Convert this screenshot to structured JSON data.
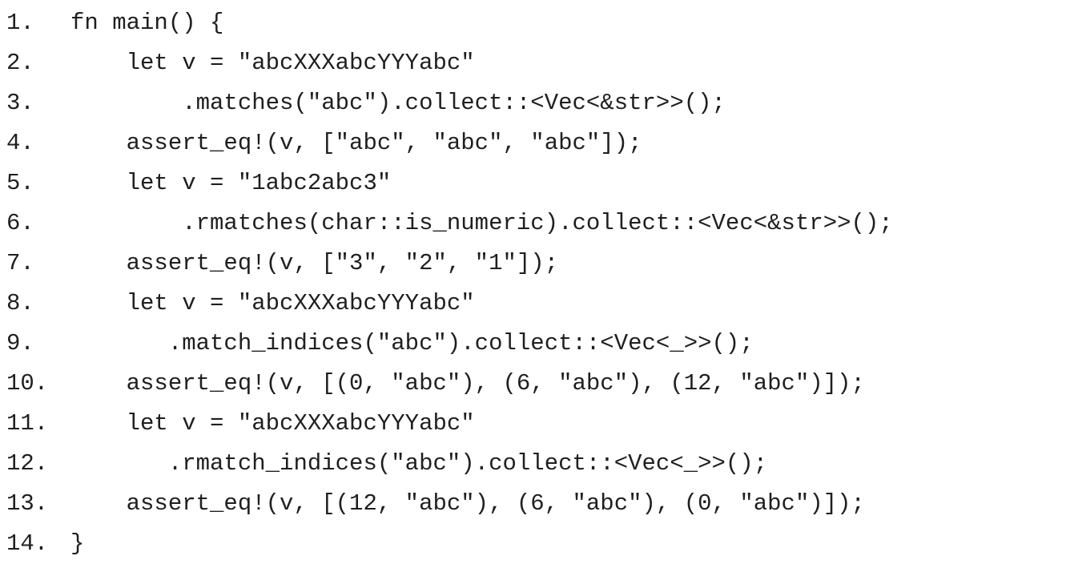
{
  "code_listing": {
    "lines": [
      {
        "number": "1.",
        "code": "fn main() {"
      },
      {
        "number": "2.",
        "code": "    let v = \"abcXXXabcYYYabc\""
      },
      {
        "number": "3.",
        "code": "        .matches(\"abc\").collect::<Vec<&str>>();"
      },
      {
        "number": "4.",
        "code": "    assert_eq!(v, [\"abc\", \"abc\", \"abc\"]);"
      },
      {
        "number": "5.",
        "code": "    let v = \"1abc2abc3\""
      },
      {
        "number": "6.",
        "code": "        .rmatches(char::is_numeric).collect::<Vec<&str>>();"
      },
      {
        "number": "7.",
        "code": "    assert_eq!(v, [\"3\", \"2\", \"1\"]);"
      },
      {
        "number": "8.",
        "code": "    let v = \"abcXXXabcYYYabc\""
      },
      {
        "number": "9.",
        "code": "       .match_indices(\"abc\").collect::<Vec<_>>();"
      },
      {
        "number": "10.",
        "code": "    assert_eq!(v, [(0, \"abc\"), (6, \"abc\"), (12, \"abc\")]);"
      },
      {
        "number": "11.",
        "code": "    let v = \"abcXXXabcYYYabc\""
      },
      {
        "number": "12.",
        "code": "       .rmatch_indices(\"abc\").collect::<Vec<_>>();"
      },
      {
        "number": "13.",
        "code": "    assert_eq!(v, [(12, \"abc\"), (6, \"abc\"), (0, \"abc\")]);"
      },
      {
        "number": "14.",
        "code": "}"
      }
    ]
  }
}
